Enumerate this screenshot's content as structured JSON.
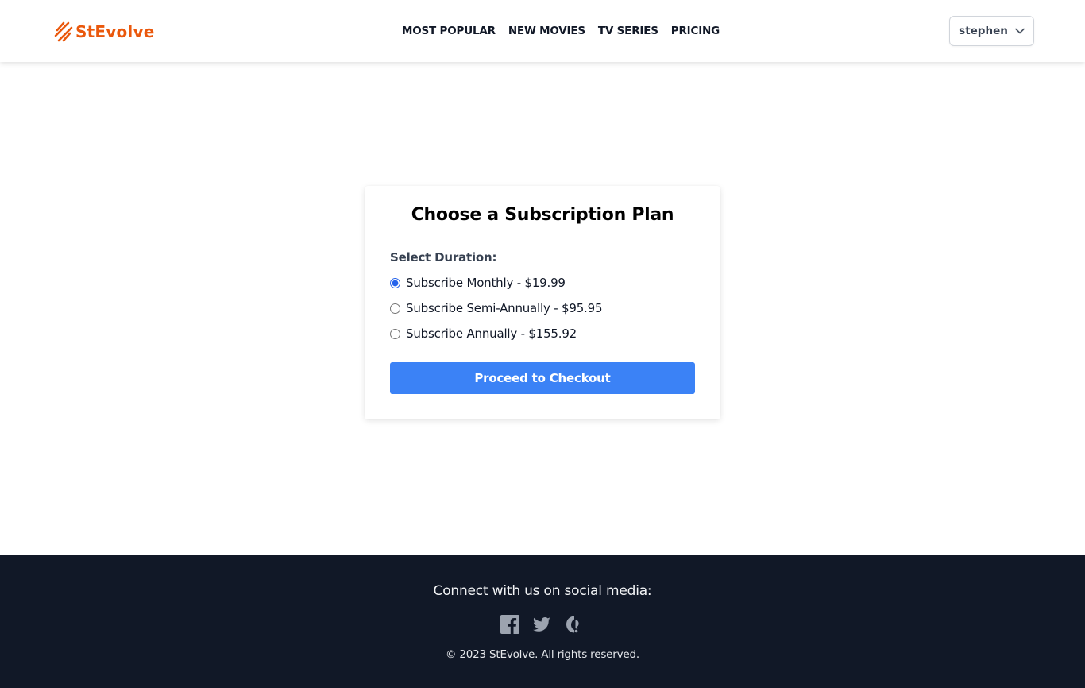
{
  "brand": {
    "name": "StEvolve",
    "color": "#ea580c",
    "icon": "lightning-logo-icon"
  },
  "nav": {
    "items": [
      {
        "label": "MOST POPULAR"
      },
      {
        "label": "NEW MOVIES"
      },
      {
        "label": "TV SERIES"
      },
      {
        "label": "PRICING"
      }
    ]
  },
  "user_menu": {
    "username": "stephen",
    "icon": "chevron-down-icon"
  },
  "subscription": {
    "title": "Choose a Subscription Plan",
    "duration_label": "Select Duration:",
    "selected": "monthly",
    "options": [
      {
        "id": "monthly",
        "label": "Subscribe Monthly - $19.99",
        "checked": true
      },
      {
        "id": "semi-annually",
        "label": "Subscribe Semi-Annually - $95.95",
        "checked": false
      },
      {
        "id": "annually",
        "label": "Subscribe Annually - $155.92",
        "checked": false
      }
    ],
    "checkout_label": "Proceed to Checkout",
    "accent": "#3b82f6"
  },
  "footer": {
    "heading": "Connect with us on social media:",
    "social": [
      {
        "icon": "facebook-icon"
      },
      {
        "icon": "twitter-icon"
      },
      {
        "icon": "mastodon-icon"
      }
    ],
    "copyright": "© 2023 StEvolve. All rights reserved.",
    "background": "#111827"
  }
}
